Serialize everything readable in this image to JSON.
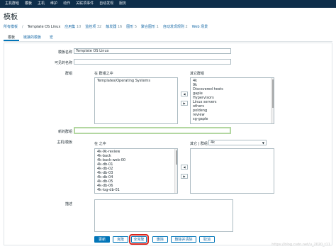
{
  "topnav": {
    "items": [
      "主机群组",
      "模板",
      "主机",
      "维护",
      "动作",
      "关联项事件",
      "自动发现",
      "服务"
    ]
  },
  "page": {
    "title": "模板"
  },
  "breadcrumb": {
    "all_templates": "所有模板",
    "sep": "/",
    "current": "Template OS Linux",
    "items": [
      {
        "label": "应用集",
        "count": "10"
      },
      {
        "label": "监控项",
        "count": "32"
      },
      {
        "label": "触发器",
        "count": "16"
      },
      {
        "label": "图形",
        "count": "5"
      },
      {
        "label": "聚合图形",
        "count": "1"
      },
      {
        "label": "自动发现规则",
        "count": "2"
      },
      {
        "label": "Web 场景",
        "count": ""
      }
    ]
  },
  "tabs": [
    "模板",
    "链接的模板",
    "宏"
  ],
  "form": {
    "template_name_label": "模板名称",
    "template_name_value": "Template OS Linux",
    "visible_name_label": "可见的名称",
    "visible_name_value": "",
    "groups_label": "群组",
    "groups_in_label": "在 群组之中",
    "groups_in": [
      "Templates/Operating Systems"
    ],
    "groups_other_label": "其它群组",
    "groups_other": [
      "4k",
      "9k",
      "Discovered hosts",
      "gaple",
      "Hypervisors",
      "Linux servers",
      "others",
      "poldeng",
      "review",
      "sg-gaple"
    ],
    "new_group_label": "新的群组",
    "new_group_value": "",
    "hosts_label": "主机/模板",
    "hosts_in_label": "在 之中",
    "hosts_in": [
      "4k-9k-review",
      "4k-back",
      "4k-back-web-00",
      "4k-db-01",
      "4k-db-02",
      "4k-db-03",
      "4k-db-04",
      "4k-db-05",
      "4k-db-06",
      "4k-log-db-01"
    ],
    "hosts_other_label": "其它 | 群组",
    "hosts_other_group": "4k",
    "hosts_other": [],
    "description_label": "描述",
    "description_value": "",
    "move_left": "◀",
    "move_right": "▶"
  },
  "buttons": {
    "update": "更新",
    "clone": "克隆",
    "full_clone": "全克隆",
    "delete": "删除",
    "delete_clear": "删除并清除",
    "cancel": "取消"
  },
  "watermark": "https://blog.csdn.net/u_2020_t11",
  "colors": {
    "topnav_bg": "#0e2e4a",
    "primary": "#0275b8",
    "link": "#1b6ca8",
    "highlight": "#d9241c"
  }
}
